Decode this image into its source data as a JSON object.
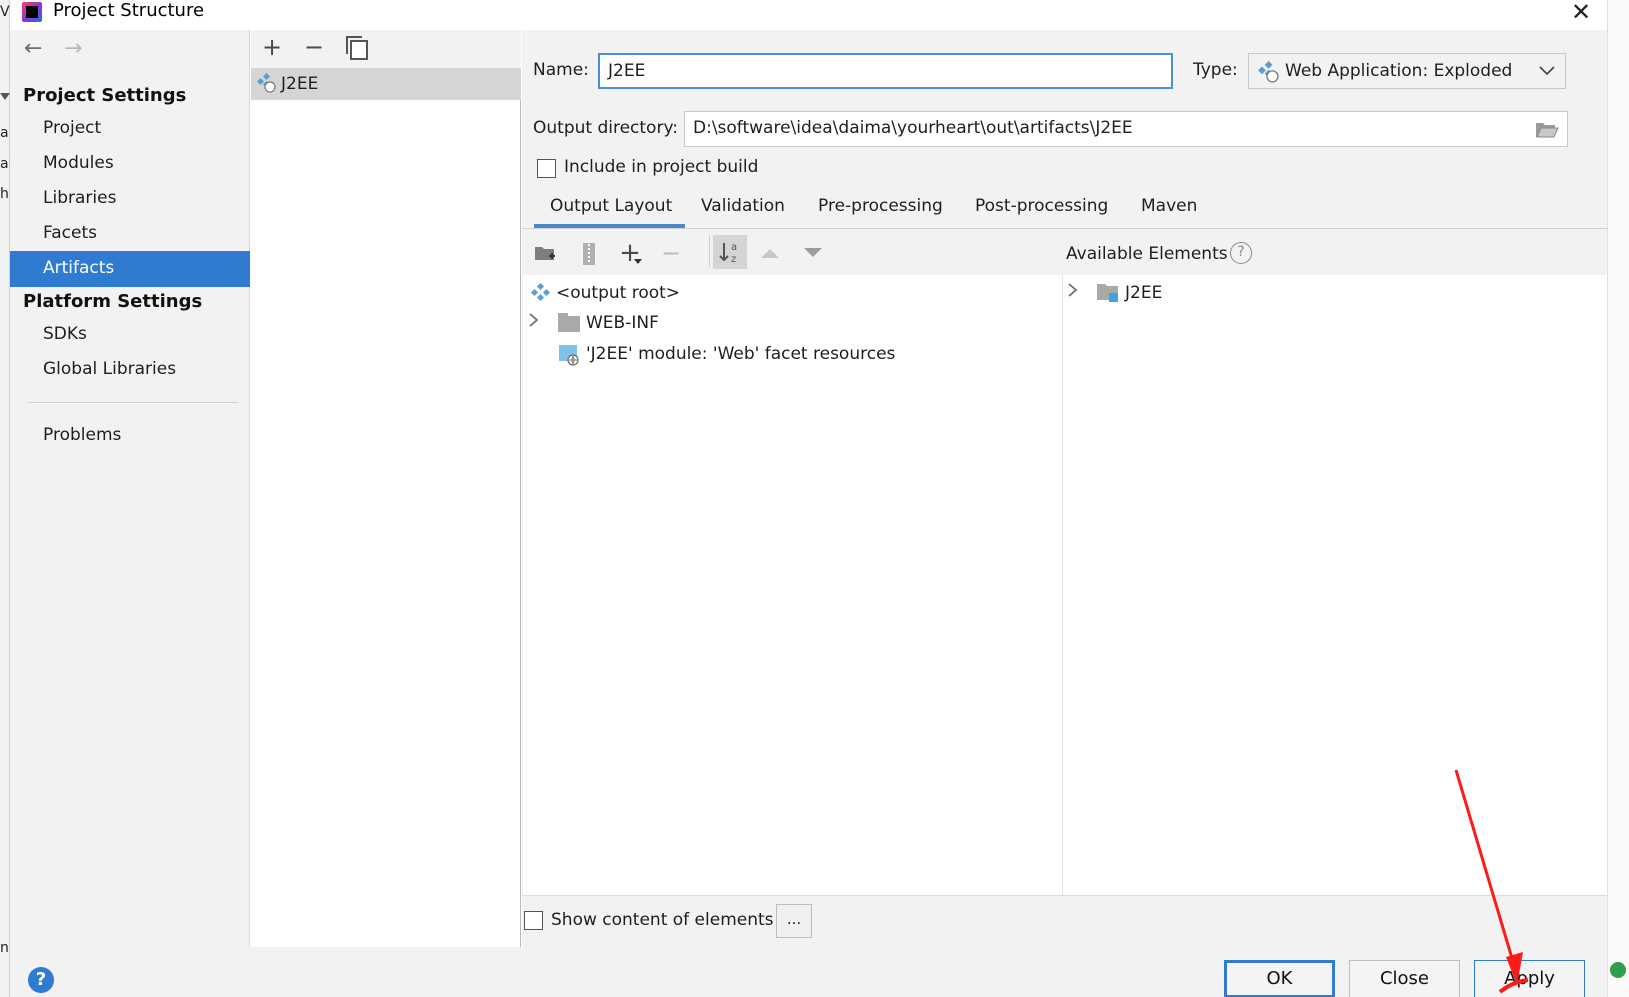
{
  "window": {
    "title": "Project Structure",
    "close_glyph": "✕"
  },
  "nav": {
    "back_glyph": "←",
    "forward_glyph": "→",
    "project_settings_title": "Project Settings",
    "project_settings_items": [
      "Project",
      "Modules",
      "Libraries",
      "Facets",
      "Artifacts"
    ],
    "selected_item": "Artifacts",
    "platform_settings_title": "Platform Settings",
    "platform_settings_items": [
      "SDKs",
      "Global Libraries"
    ],
    "problems_label": "Problems"
  },
  "artifacts_list": {
    "add_glyph": "+",
    "remove_glyph": "−",
    "items": [
      "J2EE"
    ]
  },
  "detail": {
    "name_label": "Name:",
    "name_value": "J2EE",
    "type_label": "Type:",
    "type_value": "Web Application: Exploded",
    "output_dir_label": "Output directory:",
    "output_dir_value": "D:\\software\\idea\\daima\\yourheart\\out\\artifacts\\J2EE",
    "include_in_build_label": "Include in project build",
    "include_in_build_checked": false,
    "tabs": [
      "Output Layout",
      "Validation",
      "Pre-processing",
      "Post-processing",
      "Maven"
    ],
    "active_tab": "Output Layout",
    "available_elements_label": "Available Elements",
    "help_glyph": "?",
    "output_tree": {
      "root": "<output root>",
      "folder": "WEB-INF",
      "facet_resources": "'J2EE' module: 'Web' facet resources"
    },
    "available_tree": {
      "module": "J2EE"
    },
    "show_content_label": "Show content of elements",
    "show_content_checked": false,
    "more_button_label": "..."
  },
  "footer": {
    "help_glyph": "?",
    "ok_label": "OK",
    "close_label": "Close",
    "apply_label": "Apply"
  },
  "colors": {
    "selection_blue": "#2f7bd1",
    "panel_gray": "#f2f2f2",
    "annotation_red": "#ff1a1a"
  }
}
